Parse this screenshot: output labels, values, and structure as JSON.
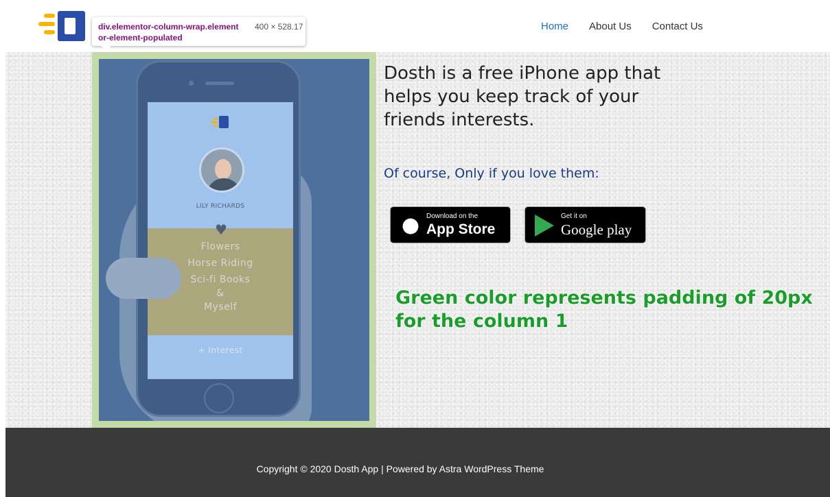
{
  "devtools_tooltip": {
    "selector": "div.elementor-column-wrap.elementor-element-populated",
    "size": "400 × 528.17"
  },
  "nav": {
    "items": [
      {
        "label": "Home",
        "active": true
      },
      {
        "label": "About Us",
        "active": false
      },
      {
        "label": "Contact Us",
        "active": false
      }
    ]
  },
  "phone_screen": {
    "profile_name": "LILY RICHARDS",
    "interests": [
      "Flowers",
      "Horse Riding",
      "Sci-fi Books",
      "&",
      "Myself"
    ],
    "add_interest": "+ Interest"
  },
  "hero": {
    "headline": "Dosth is a free iPhone app that helps you keep track of your friends interests.",
    "subline": "Of course, Only if you love them:",
    "apple_button": {
      "small": "Download on the",
      "big": "App Store"
    },
    "google_button": {
      "small": "Get it on",
      "big": "Google play"
    },
    "annotation": "Green color represents padding of 20px for the column 1"
  },
  "footer": {
    "copyright": "Copyright © 2020 Dosth App | Powered by Astra WordPress Theme"
  },
  "colors": {
    "padding_overlay": "#c3dba8",
    "content_overlay": "#4d709c",
    "nav_active": "#1f6fc7",
    "annotation": "#1a9e2a",
    "footer_bg": "#3a3a3a"
  }
}
